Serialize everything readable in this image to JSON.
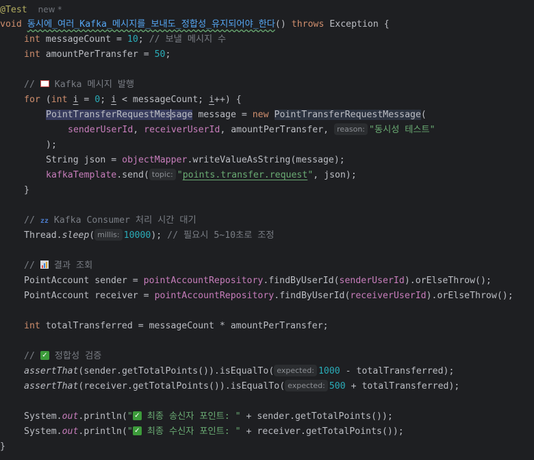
{
  "annotation": "@Test",
  "annotation_meta": "new *",
  "signature": {
    "void": "void",
    "method_name": "동시에_여러_Kafka_메시지를_보내도_정합성_유지되어야_한다",
    "parens": "()",
    "throws": "throws",
    "exception": "Exception {"
  },
  "line_count": {
    "type": "int",
    "name": "messageCount",
    "assign": " = ",
    "value": "10",
    "semi": ";",
    "comment": "// 보낼 메시지 수"
  },
  "line_amount": {
    "type": "int",
    "name": "amountPerTransfer",
    "assign": " = ",
    "value": "50",
    "semi": ";"
  },
  "comment_publish": {
    "prefix": "//",
    "text": "Kafka 메시지 발행",
    "icon": "mail-icon"
  },
  "for_loop": {
    "for": "for",
    "open": " (",
    "int": "int",
    "i": "i",
    "eq": " = ",
    "zero": "0",
    "lt": "; ",
    "i2": "i",
    "cond": " < messageCount; ",
    "i3": "i",
    "incr": "++) {"
  },
  "msg_decl": {
    "type_a": "PointTransferRequestMes",
    "type_b": "sage",
    "var": " message = ",
    "new": "new",
    "ctor": "PointTransferRequestMessage",
    "paren": "("
  },
  "args_line": {
    "a1": "senderUserId",
    "c1": ", ",
    "a2": "receiverUserId",
    "c2": ", amountPerTransfer, ",
    "hint": "reason:",
    "str": "\"동시성 테스트\""
  },
  "close_paren": ");",
  "json_line": {
    "prefix": "String json = ",
    "mapper": "objectMapper",
    "dot": ".",
    "method": "writeValueAsString",
    "rest": "(message);"
  },
  "send_line": {
    "tmpl": "kafkaTemplate",
    "dot": ".",
    "method": "send",
    "open": "(",
    "hint": "topic:",
    "q1": "\"",
    "topic": "points.transfer.request",
    "q2": "\"",
    "rest": ", json);"
  },
  "close_for": "}",
  "comment_wait": {
    "prefix": "//",
    "text": "Kafka Consumer 처리 시간 대기",
    "icon": "sleep-icon",
    "icon_text": "zz"
  },
  "sleep_line": {
    "cls": "Thread.",
    "method": "sleep",
    "open": "(",
    "hint": "millis:",
    "value": "10000",
    "close": ");",
    "comment": "// 필요시 5~10초로 조정"
  },
  "comment_result": {
    "prefix": "//",
    "text": "결과 조회",
    "icon": "chart-icon"
  },
  "sender_line": {
    "prefix": "PointAccount sender = ",
    "repo": "pointAccountRepository",
    "dot": ".",
    "method": "findByUserId",
    "open": "(",
    "arg": "senderUserId",
    "close": ").",
    "throw": "orElseThrow",
    "end": "();"
  },
  "receiver_line": {
    "prefix": "PointAccount receiver = ",
    "repo": "pointAccountRepository",
    "dot": ".",
    "method": "findByUserId",
    "open": "(",
    "arg": "receiverUserId",
    "close": ").",
    "throw": "orElseThrow",
    "end": "();"
  },
  "total_line": {
    "int": "int",
    "rest": " totalTransferred = messageCount * amountPerTransfer;"
  },
  "comment_check": {
    "prefix": "//",
    "text": "정합성 검증",
    "icon": "check-icon",
    "icon_text": "✓"
  },
  "assert1": {
    "fn": "assertThat",
    "mid": "(sender.",
    "m1": "getTotalPoints",
    "mid2": "()).",
    "m2": "isEqualTo",
    "open": "(",
    "hint": "expected:",
    "value": "1000",
    "rest": " - totalTransferred);"
  },
  "assert2": {
    "fn": "assertThat",
    "mid": "(receiver.",
    "m1": "getTotalPoints",
    "mid2": "()).",
    "m2": "isEqualTo",
    "open": "(",
    "hint": "expected:",
    "value": "500",
    "rest": " + totalTransferred);"
  },
  "print1": {
    "sys": "System.",
    "out": "out",
    "dot": ".",
    "m": "println",
    "open": "(",
    "q": "\"",
    "check": "✓",
    "str": " 최종 송신자 포인트: \"",
    "plus": " + sender.",
    "m2": "getTotalPoints",
    "end": "());"
  },
  "print2": {
    "sys": "System.",
    "out": "out",
    "dot": ".",
    "m": "println",
    "open": "(",
    "q": "\"",
    "check": "✓",
    "str": " 최종 수신자 포인트: \"",
    "plus": " + receiver.",
    "m2": "getTotalPoints",
    "end": "());"
  },
  "close_method": "}",
  "colors": {
    "background": "#1e1f22",
    "keyword": "#cf8e6d",
    "number": "#2aacb8",
    "string": "#6aab73",
    "comment": "#7a7e85",
    "method": "#56a8f5",
    "field": "#c77dbb",
    "annotation": "#b3ae60"
  }
}
